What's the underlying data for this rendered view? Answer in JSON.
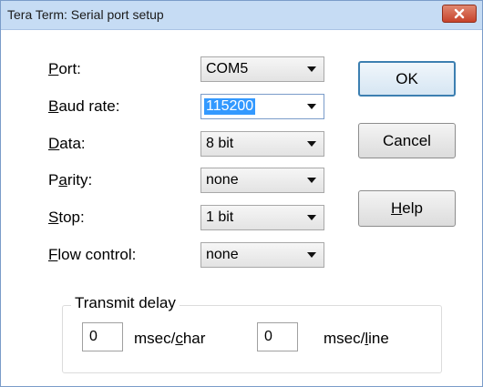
{
  "window": {
    "title": "Tera Term: Serial port setup"
  },
  "fields": [
    {
      "id": "port",
      "pre": "",
      "acc": "P",
      "post": "ort:",
      "value": "COM5"
    },
    {
      "id": "baud",
      "pre": "",
      "acc": "B",
      "post": "aud rate:",
      "value": "115200"
    },
    {
      "id": "data",
      "pre": "",
      "acc": "D",
      "post": "ata:",
      "value": "8 bit"
    },
    {
      "id": "parity",
      "pre": "P",
      "acc": "a",
      "post": "rity:",
      "value": "none"
    },
    {
      "id": "stop",
      "pre": "",
      "acc": "S",
      "post": "top:",
      "value": "1 bit"
    },
    {
      "id": "flow",
      "pre": "",
      "acc": "F",
      "post": "low control:",
      "value": "none"
    }
  ],
  "buttons": {
    "ok": "OK",
    "cancel": "Cancel",
    "help_acc": "H",
    "help_rest": "elp"
  },
  "transmit": {
    "group_label": "Transmit delay",
    "char_value": "0",
    "char_unit_pre": "msec/",
    "char_unit_acc": "c",
    "char_unit_post": "har",
    "line_value": "0",
    "line_unit_pre": "msec/",
    "line_unit_acc": "l",
    "line_unit_post": "ine"
  },
  "icons": {
    "close": "close-icon",
    "dropdown": "chevron-down-icon"
  }
}
